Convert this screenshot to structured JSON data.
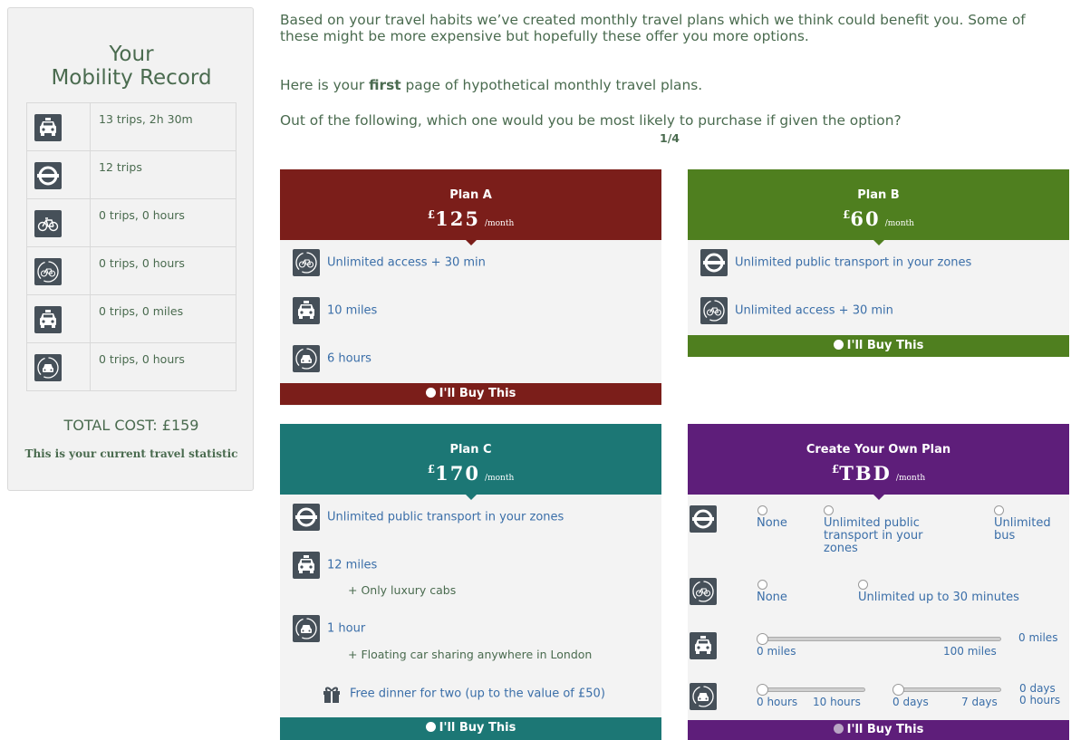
{
  "sidebar": {
    "title_line1": "Your",
    "title_line2": "Mobility Record",
    "rows": [
      {
        "icon": "taxi-icon",
        "text": "13 trips, 2h 30m"
      },
      {
        "icon": "underground-icon",
        "text": "12 trips"
      },
      {
        "icon": "bicycle-icon",
        "text": "0 trips, 0 hours"
      },
      {
        "icon": "bike-share-icon",
        "text": "0 trips, 0 hours"
      },
      {
        "icon": "taxi-icon",
        "text": "0 trips, 0 miles"
      },
      {
        "icon": "car-share-icon",
        "text": "0 trips, 0 hours"
      }
    ],
    "total": "TOTAL COST: £159",
    "note": "This is your current travel statistic"
  },
  "intro": {
    "line1": "Based on your travel habits we’ve created monthly travel plans which we think could benefit you. Some of these might be more expensive but hopefully these offer you more options.",
    "line2_pre": "Here is your ",
    "line2_bold": "first",
    "line2_post": " page of hypothetical monthly travel plans.",
    "line3": "Out of the following, which one would you be most likely to purchase if given the option?",
    "pager": "1/4"
  },
  "plans": {
    "a": {
      "name": "Plan A",
      "currency": "£",
      "amount": "125",
      "per": "/month",
      "rows": [
        "Unlimited access + 30 min",
        "10 miles",
        "6 hours"
      ],
      "buy": "I'll Buy This"
    },
    "b": {
      "name": "Plan B",
      "currency": "£",
      "amount": "60",
      "per": "/month",
      "rows": [
        "Unlimited public transport in your zones",
        "Unlimited access + 30 min"
      ],
      "buy": "I'll Buy This"
    },
    "c": {
      "name": "Plan C",
      "currency": "£",
      "amount": "170",
      "per": "/month",
      "rows": [
        "Unlimited public transport in your zones",
        "12 miles",
        "1 hour"
      ],
      "subs": [
        "+ Only luxury cabs",
        "+ Floating car sharing anywhere in London"
      ],
      "gift": "Free dinner for two (up to the value of £50)",
      "buy": "I'll Buy This"
    },
    "custom": {
      "name": "Create Your Own Plan",
      "currency": "£",
      "amount": "TBD",
      "per": "/month",
      "transport_opts": [
        "None",
        "Unlimited public transport in your zones",
        "Unlimited bus"
      ],
      "bike_opts": [
        "None",
        "Unlimited up to 30 minutes"
      ],
      "taxi": {
        "min": "0 miles",
        "max": "100 miles",
        "value": "0 miles"
      },
      "car_hours": {
        "min": "0 hours",
        "max": "10 hours"
      },
      "car_days": {
        "min": "0 days",
        "max": "7 days"
      },
      "car_value_days": "0 days",
      "car_value_hours": "0 hours",
      "buy": "I'll Buy This"
    }
  },
  "colors": {
    "plan_a": "#7b1e1a",
    "plan_b": "#4f7f1f",
    "plan_c": "#1c7775",
    "custom": "#5e1e7a"
  }
}
